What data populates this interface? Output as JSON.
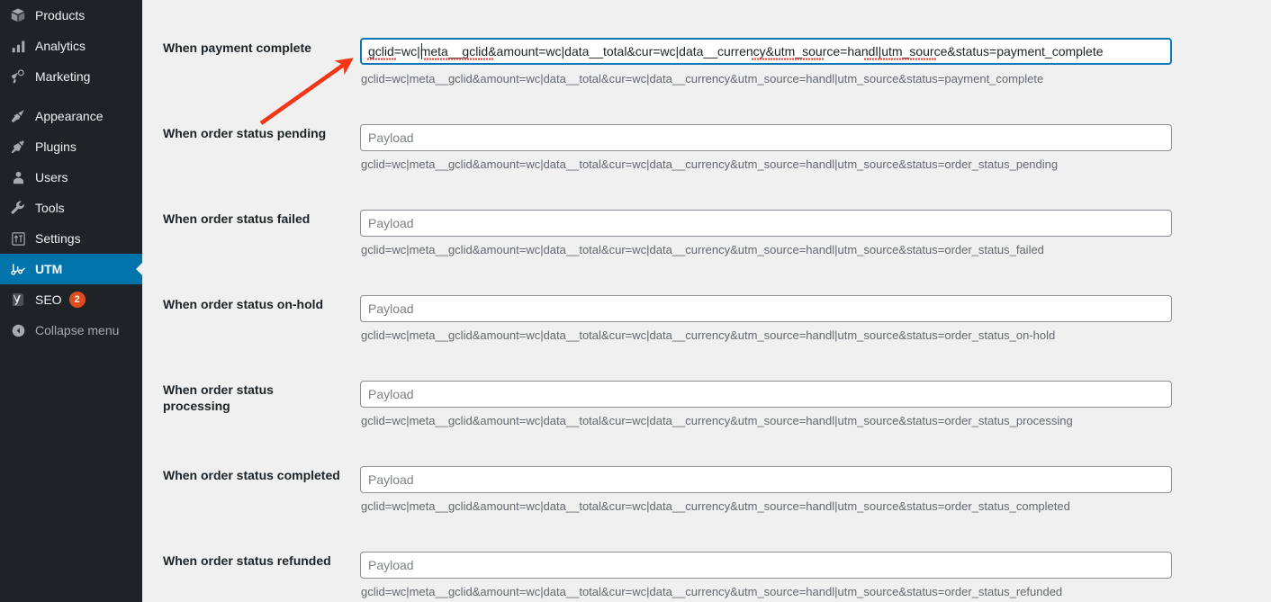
{
  "sidebar": {
    "items": [
      {
        "label": "Products",
        "icon": "box-icon",
        "current": false
      },
      {
        "label": "Analytics",
        "icon": "bar-chart-icon",
        "current": false
      },
      {
        "label": "Marketing",
        "icon": "megaphone-icon",
        "current": false
      },
      {
        "label": "Appearance",
        "icon": "paintbrush-icon",
        "current": false
      },
      {
        "label": "Plugins",
        "icon": "plug-icon",
        "current": false
      },
      {
        "label": "Users",
        "icon": "user-icon",
        "current": false
      },
      {
        "label": "Tools",
        "icon": "wrench-icon",
        "current": false
      },
      {
        "label": "Settings",
        "icon": "sliders-icon",
        "current": false
      },
      {
        "label": "UTM",
        "icon": "utm-icon",
        "current": true
      },
      {
        "label": "SEO",
        "icon": "yoast-icon",
        "current": false,
        "badge": "2"
      },
      {
        "label": "Collapse menu",
        "icon": "collapse-icon",
        "current": false
      }
    ],
    "badge_color": "#dd4c1e",
    "current_color": "#0073aa",
    "background_color": "#1d2327"
  },
  "main": {
    "placeholder": "Payload",
    "focused_value": "gclid=wc|meta__gclid&amount=wc|data__total&cur=wc|data__currency&utm_source=handl|utm_source&status=payment_complete",
    "fields": [
      {
        "label": "When payment complete",
        "value": "gclid=wc|meta__gclid&amount=wc|data__total&cur=wc|data__currency&utm_source=handl|utm_source&status=payment_complete",
        "help": "gclid=wc|meta__gclid&amount=wc|data__total&cur=wc|data__currency&utm_source=handl|utm_source&status=payment_complete",
        "focused": true
      },
      {
        "label": "When order status pending",
        "value": "",
        "help": "gclid=wc|meta__gclid&amount=wc|data__total&cur=wc|data__currency&utm_source=handl|utm_source&status=order_status_pending",
        "focused": false
      },
      {
        "label": "When order status failed",
        "value": "",
        "help": "gclid=wc|meta__gclid&amount=wc|data__total&cur=wc|data__currency&utm_source=handl|utm_source&status=order_status_failed",
        "focused": false
      },
      {
        "label": "When order status on-hold",
        "value": "",
        "help": "gclid=wc|meta__gclid&amount=wc|data__total&cur=wc|data__currency&utm_source=handl|utm_source&status=order_status_on-hold",
        "focused": false
      },
      {
        "label": "When order status processing",
        "value": "",
        "help": "gclid=wc|meta__gclid&amount=wc|data__total&cur=wc|data__currency&utm_source=handl|utm_source&status=order_status_processing",
        "focused": false
      },
      {
        "label": "When order status completed",
        "value": "",
        "help": "gclid=wc|meta__gclid&amount=wc|data__total&cur=wc|data__currency&utm_source=handl|utm_source&status=order_status_completed",
        "focused": false
      },
      {
        "label": "When order status refunded",
        "value": "",
        "help": "gclid=wc|meta__gclid&amount=wc|data__total&cur=wc|data__currency&utm_source=handl|utm_source&status=order_status_refunded",
        "focused": false
      }
    ]
  },
  "annotation": {
    "arrow_color": "#f23616",
    "points_to": "When payment complete payload input"
  }
}
